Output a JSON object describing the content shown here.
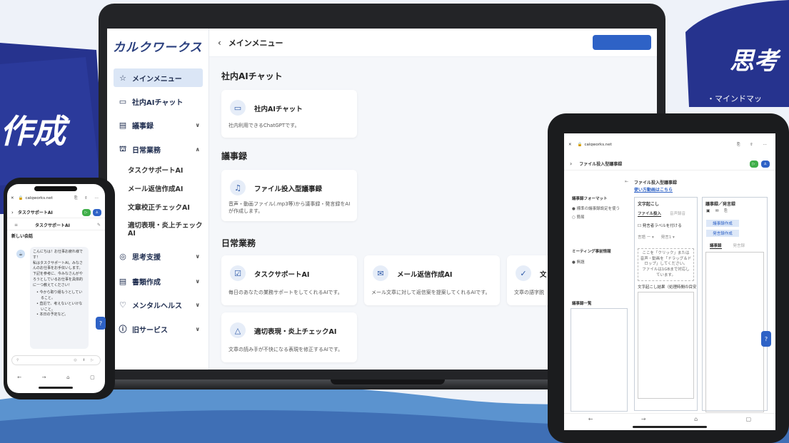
{
  "colors": {
    "navy": "#26338e",
    "accent": "#2e62c6",
    "green": "#3fae49",
    "bg": "#eef2f9"
  },
  "banners": {
    "left_title": "作成",
    "right_title": "思考",
    "right_caption": "・マインドマッ"
  },
  "laptop": {
    "brand": "カルクワークス",
    "topbar": {
      "back": "‹",
      "title": "メインメニュー"
    },
    "sidebar": {
      "items": [
        {
          "label": "メインメニュー",
          "icon": "☆",
          "chev": ""
        },
        {
          "label": "社内AIチャット",
          "icon": "▭",
          "chev": ""
        },
        {
          "label": "議事録",
          "icon": "▤",
          "chev": "∨"
        },
        {
          "label": "日常業務",
          "icon": "⛫",
          "chev": "∧"
        },
        {
          "label": "思考支援",
          "icon": "◎",
          "chev": "∨"
        },
        {
          "label": "書類作成",
          "icon": "▤",
          "chev": "∨"
        },
        {
          "label": "メンタルヘルス",
          "icon": "♡",
          "chev": "∨"
        },
        {
          "label": "旧サービス",
          "icon": "ⓘ",
          "chev": "∨"
        }
      ],
      "subitems": [
        "タスクサポートAI",
        "メール返信作成AI",
        "文章校正チェックAI",
        "適切表現・炎上チェック",
        "AI"
      ]
    },
    "sections": {
      "chat": "社内AIチャット",
      "minutes": "議事録",
      "daily": "日常業務"
    },
    "cards": {
      "chat": {
        "title": "社内AIチャット",
        "desc": "社内利用できるChatGPTです。"
      },
      "file": {
        "title": "ファイル投入型議事録",
        "desc1": "音声・動画ファイル(.mp3等)から議事録・発言録をAI",
        "desc2": "が作成します。"
      },
      "task": {
        "title": "タスクサポートAI",
        "desc": "毎日のあなたの業務サポートをしてくれるAIです。"
      },
      "mail": {
        "title": "メール返信作成AI",
        "desc": "メール文章に対して返信案を提案してくれるAIです。"
      },
      "proof": {
        "title": "文",
        "desc": "文章の語字脱"
      },
      "flame": {
        "title": "適切表現・炎上チェックAI",
        "desc": "文章の読み手が不快になる表現を修正するAIです。"
      }
    }
  },
  "phone": {
    "url": "calqworks.net",
    "page_title": "タスクサポートAI",
    "chat_title": "タスクサポートAI",
    "new_chat": "新しい会話",
    "messages": [
      "こんにちは！お仕事お疲れ様で",
      "す！",
      "私はタスクサポートAI。みなさ",
      "んのお仕事をお手伝いします。",
      "下記を参考に、今みなさんがや",
      "ろうとしているお仕事を具体的",
      "にーつ教えてください！"
    ],
    "bullets": [
      "今から取り組もうとしてい",
      "ること。",
      "直近で、考えないといけな",
      "いこと。",
      "本日の予定など。"
    ],
    "input_placeholder": "送信"
  },
  "tablet": {
    "url": "calqworks.net",
    "page_title": "ファイル投入型議事録",
    "heading": "ファイル投入型議事録",
    "video_link": "使い方動画はこちら",
    "format_label": "議事録フォーマット",
    "format_opt1": "標準の議事録設定を使う",
    "format_opt2": "簡易",
    "meeting_info": "ミーティング事前情報",
    "meeting_opt": "無題",
    "minutes_list": "議事録一覧",
    "transcribe": "文字起こし",
    "tab_file": "ファイル投入",
    "tab_record": "音声録音",
    "speaker_label": "発言者ラベルを付ける",
    "lang_label": "言語",
    "lang_value": "ー",
    "speaker_count": "発言1",
    "drop_text": [
      "ここを「クリック」または",
      "音声・動画を「ドラッグ＆ド",
      "ロップ」してください。",
      "ファイルは1GBまで対応し",
      "ています。"
    ],
    "result_label": "文字起こし結果（処理時間の目安は",
    "right_title": "議事録／発言録",
    "btn_minutes": "議事録作成",
    "btn_speech": "発言録作成",
    "tab_minutes": "議事録",
    "tab_speech": "発言録"
  }
}
